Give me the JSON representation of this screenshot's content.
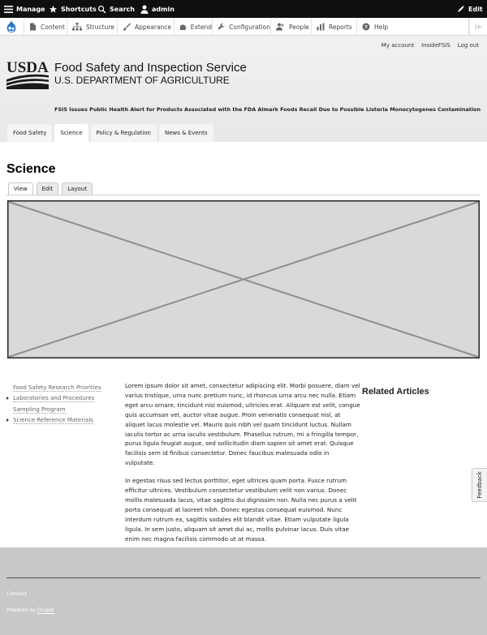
{
  "toolbar": {
    "manage": "Manage",
    "shortcuts": "Shortcuts",
    "search": "Search",
    "user": "admin",
    "edit": "Edit"
  },
  "admin_menu": {
    "items": [
      "Content",
      "Structure",
      "Appearance",
      "Extend",
      "Configuration",
      "People",
      "Reports",
      "Help"
    ]
  },
  "header": {
    "secondary_links": [
      "My account",
      "InsideFSIS",
      "Log out"
    ],
    "logo_text": "USDA",
    "site_name": "Food Safety and Inspection Service",
    "site_slogan": "U.S. DEPARTMENT OF AGRICULTURE",
    "alert": "FSIS Issues Public Health Alert for Products Associated with the FDA Almark Foods Recall Due to Possible Listeria Monocytogenes Contamination",
    "nav": [
      "Food Safety",
      "Science",
      "Policy & Regulation",
      "News & Events"
    ]
  },
  "page": {
    "title": "Science",
    "local_tabs": [
      "View",
      "Edit",
      "Layout"
    ]
  },
  "sidebar": {
    "items": [
      "Food Safety Research Priorities",
      "Laboratories and Procedures",
      "Sampling Program",
      "Science Reference Materials"
    ]
  },
  "content": {
    "paragraph1": "Lorem ipsum dolor sit amet, consectetur adipiscing elit. Morbi posuere, diam vel varius tristique, urna nunc pretium nunc, id rhoncus urna arcu nec nulla. Etiam eget arcu ornare, tincidunt nisl euismod, ultricies erat. Aliquam est velit, congue quis accumsan vel, auctor vitae augue. Proin venenatis consequat nisl, at aliquet lacus molestie vel. Mauris quis nibh vel quam tincidunt luctus. Nullam iaculis tortor ac urna iaculis vestibulum. Phasellus rutrum, mi a fringilla tempor, purus ligula feugiat augue, sed sollicitudin diam sapien sit amet erat. Quisque facilisis sem id finibus consectetur. Donec faucibus malesuada odio in vulputate.",
    "paragraph2": "In egestas risus sed lectus porttitor, eget ultrices quam porta. Fusce rutrum efficitur ultrices. Vestibulum consectetur vestibulum velit non varius. Donec mollis malesuada lacus, vitae sagittis dui dignissim non. Nulla nec purus a velit porta consequat at laoreet nibh. Donec egestas consequat euismod. Nunc interdum rutrum ex, sagittis sodales elit blandit vitae. Etiam vulputate ligula ligula. In sem justo, aliquam sit amet dui ac, mollis pulvinar lacus. Duis vitae enim nec magna facilisis commodo ut at massa."
  },
  "related": {
    "title": "Related Articles"
  },
  "feedback": {
    "label": "Feedback"
  },
  "footer": {
    "contact": "Contact",
    "powered_prefix": "Powered by ",
    "powered_link": "Drupal"
  }
}
